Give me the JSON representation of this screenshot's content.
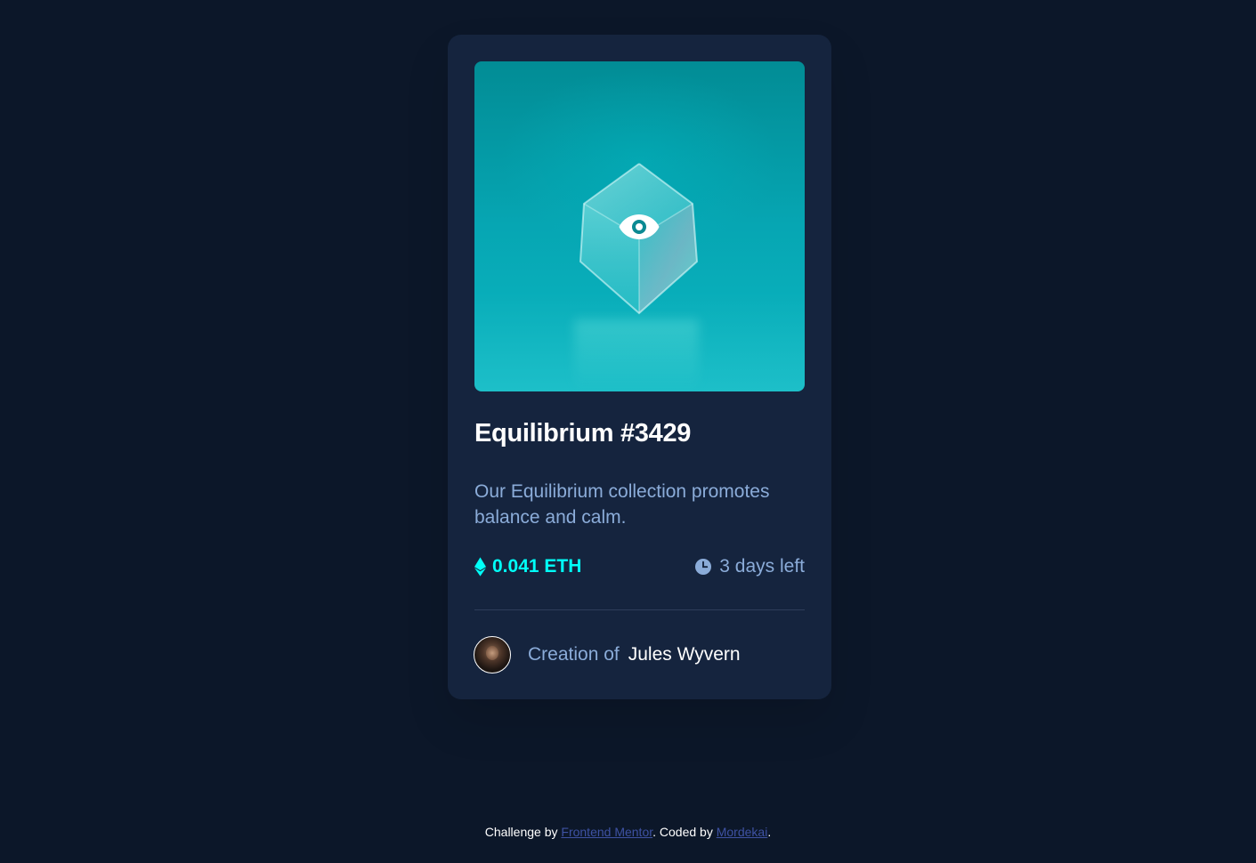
{
  "colors": {
    "page_background": "#0c1729",
    "card_background": "#15243e",
    "accent_cyan": "#00fff8",
    "soft_blue": "#8bacd9",
    "link_blue": "#3e52a3",
    "white": "#ffffff"
  },
  "card": {
    "image_overlay_icon": "eye-icon",
    "title": "Equilibrium #3429",
    "description": "Our Equilibrium collection promotes balance and calm.",
    "price": {
      "icon": "ethereum-icon",
      "value": "0.041 ETH"
    },
    "time_left": {
      "icon": "clock-icon",
      "value": "3 days left"
    },
    "creator": {
      "label": "Creation of",
      "name": "Jules Wyvern"
    }
  },
  "attribution": {
    "challenge_prefix": "Challenge by ",
    "challenge_link": "Frontend Mentor",
    "coded_prefix": ". Coded by ",
    "coded_link": "Mordekai",
    "suffix": "."
  }
}
